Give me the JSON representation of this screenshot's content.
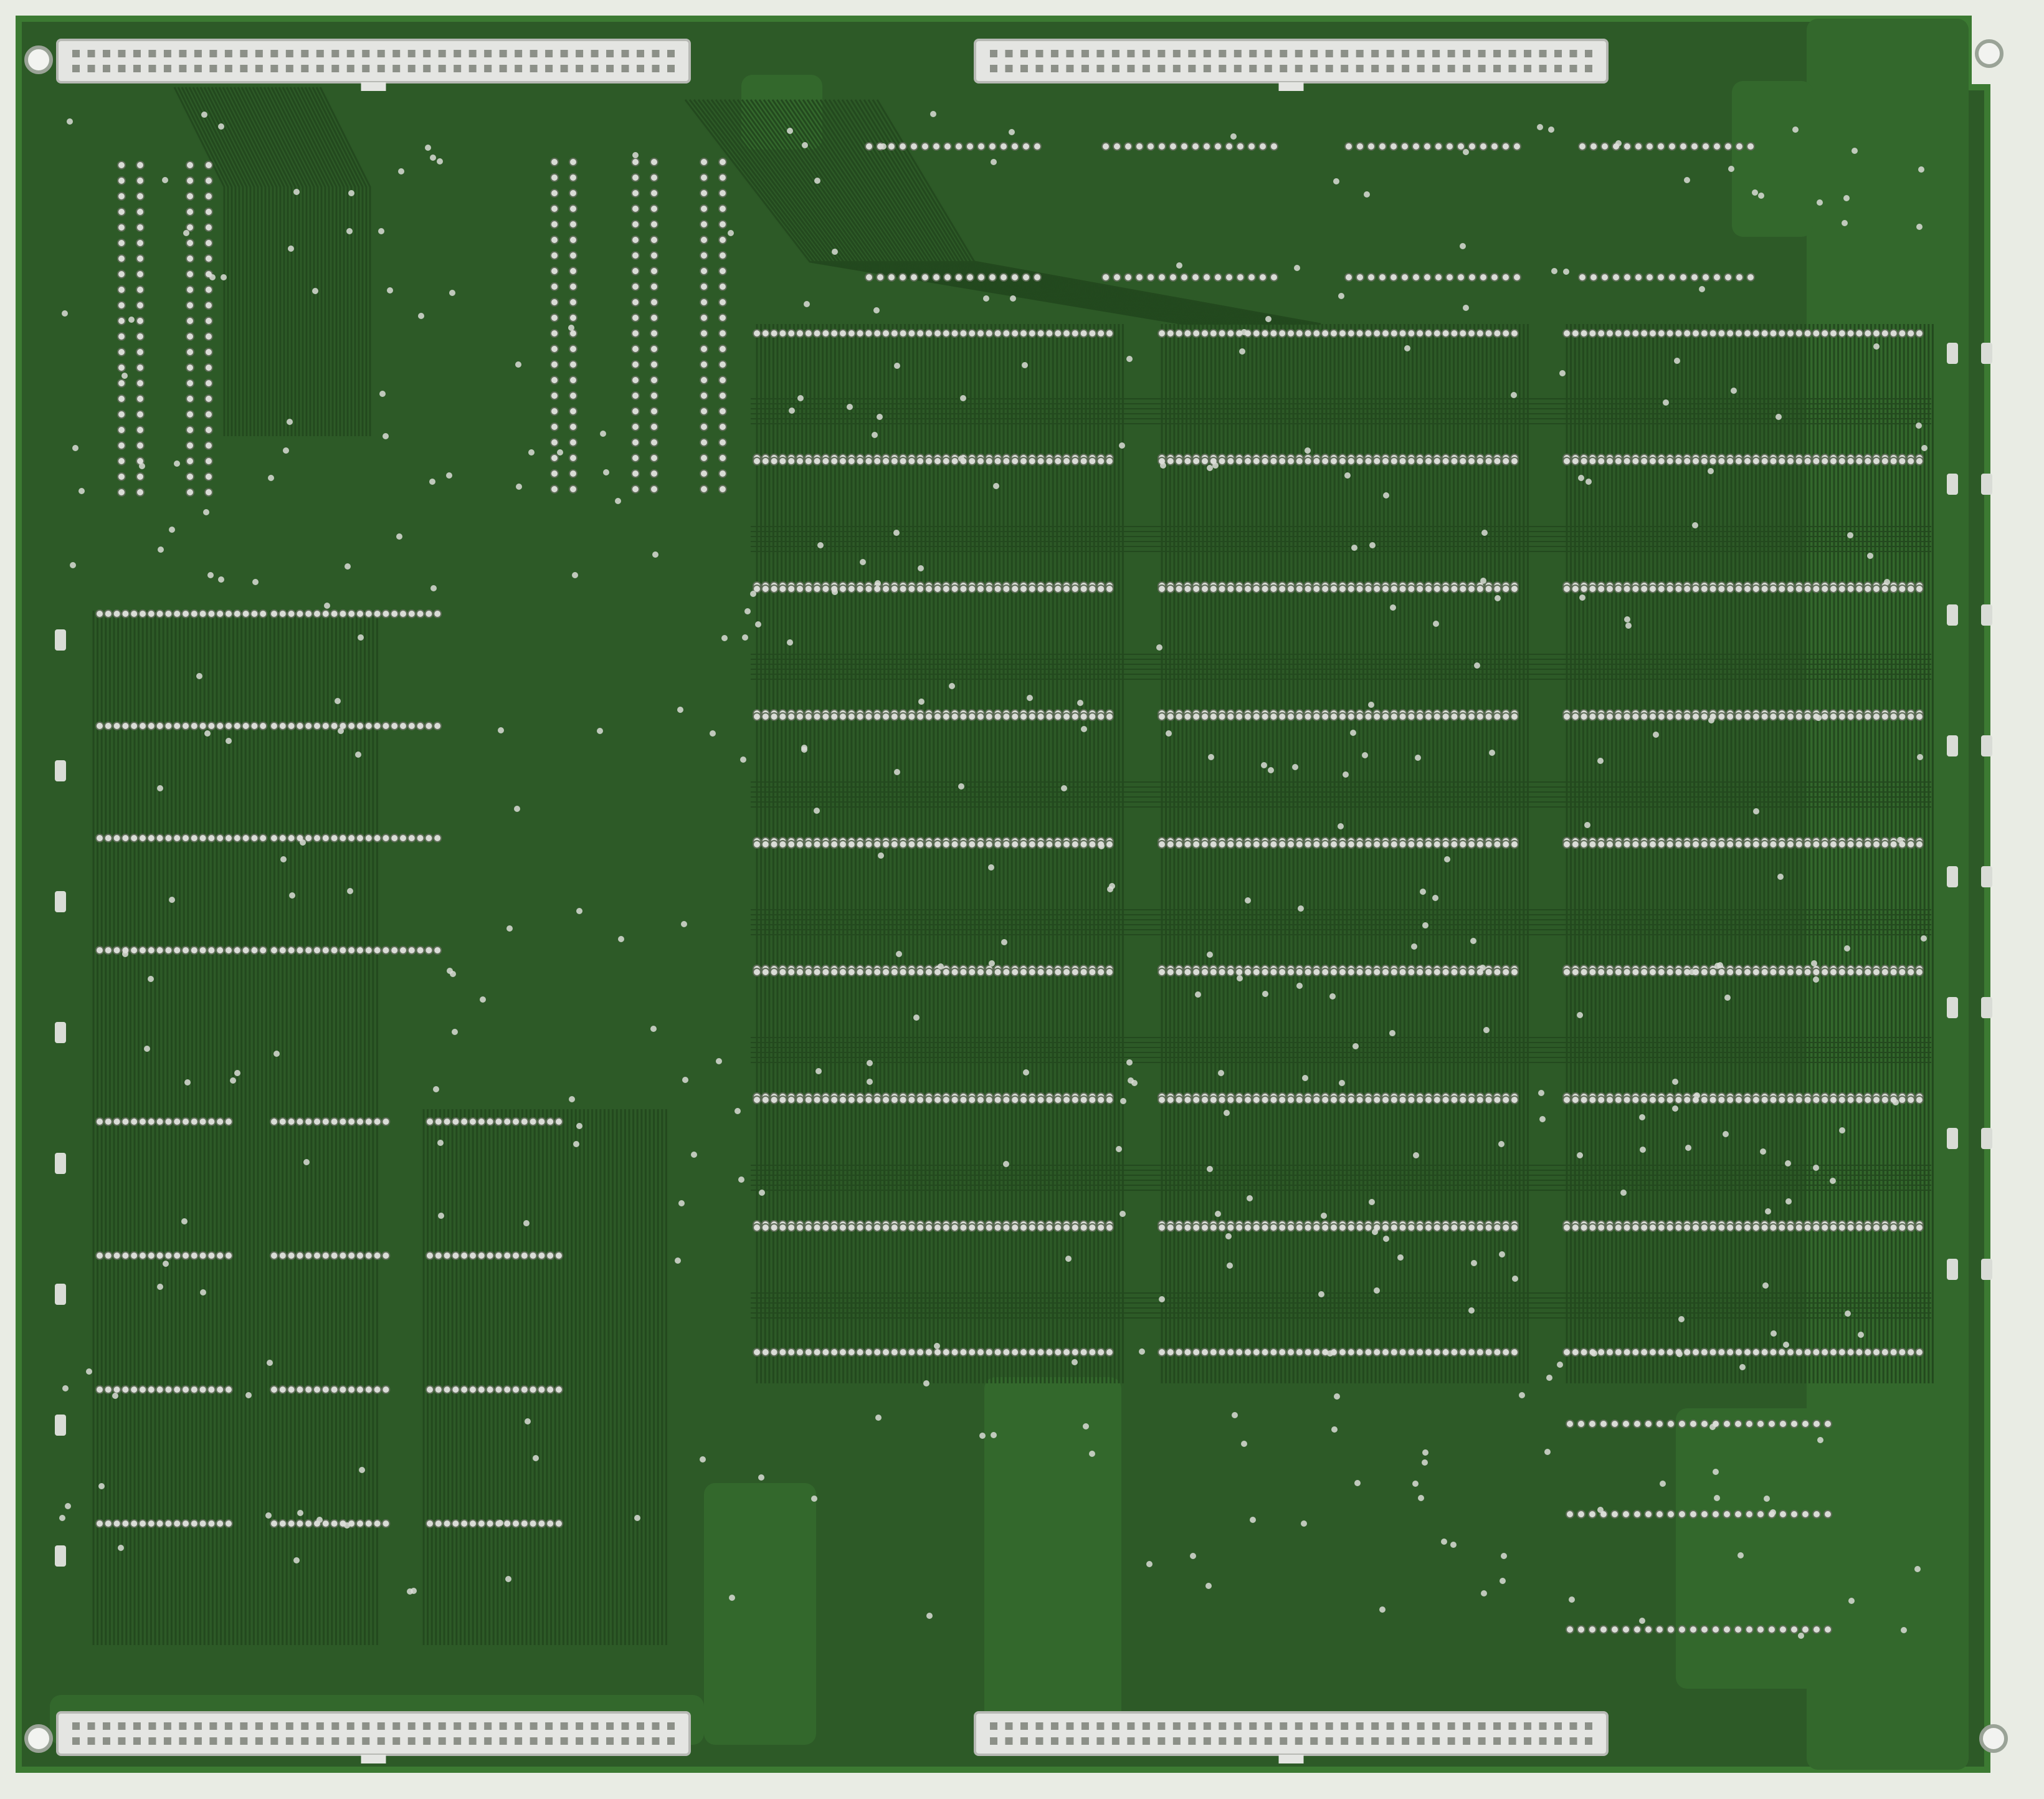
{
  "photo": {
    "subject": "pcb-solder-side",
    "colors": {
      "background": "#e9ece4",
      "board": "#2d5a27",
      "board_edge": "#3c7a32",
      "copper_pour": "#33682c",
      "trace": "#23491e",
      "trace_light": "#4e8a44",
      "pad": "#d9dcd6",
      "pad_hole": "#5c6b55",
      "connector_body": "#e4e5e2",
      "connector_pin": "#8c9088",
      "mount_hole": "#f2f3f0"
    },
    "connectors": [
      {
        "name": "connector-top-left",
        "pins_per_row": 40
      },
      {
        "name": "connector-top-right",
        "pins_per_row": 40
      },
      {
        "name": "connector-bottom-left",
        "pins_per_row": 40
      },
      {
        "name": "connector-bottom-right",
        "pins_per_row": 40
      }
    ],
    "chip_columns": 3,
    "chip_rows": 8
  }
}
